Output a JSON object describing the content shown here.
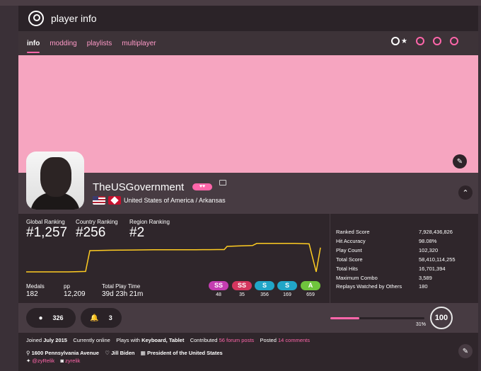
{
  "header": {
    "title": "player info"
  },
  "tabs": [
    {
      "label": "info",
      "active": true
    },
    {
      "label": "modding",
      "active": false
    },
    {
      "label": "playlists",
      "active": false
    },
    {
      "label": "multiplayer",
      "active": false
    }
  ],
  "modes": [
    "osu-icon",
    "taiko-icon",
    "catch-icon",
    "mania-icon"
  ],
  "profile": {
    "username": "TheUSGovernment",
    "supporter_badge": "♥♥",
    "location": "United States of America / Arkansas",
    "flags": [
      "us-flag-icon",
      "arkansas-flag-icon"
    ]
  },
  "rankings": {
    "global_label": "Global Ranking",
    "global_value": "#1,257",
    "country_label": "Country Ranking",
    "country_value": "#256",
    "region_label": "Region Ranking",
    "region_value": "#2"
  },
  "chart_data": {
    "type": "line",
    "title": "",
    "xlabel": "",
    "ylabel": "",
    "series": [
      {
        "values": [
          2400,
          2400,
          2400,
          2380,
          1400,
          1380,
          1370,
          1360,
          1360,
          1360,
          1355,
          1355,
          1350,
          1350,
          1200,
          1180,
          1160,
          1060,
          1060,
          1060,
          1060,
          1080,
          2400,
          1257
        ]
      }
    ],
    "ylim": [
      1000,
      2600
    ]
  },
  "summary_stats": [
    {
      "label": "Medals",
      "value": "182"
    },
    {
      "label": "pp",
      "value": "12,209"
    },
    {
      "label": "Total Play Time",
      "value": "39d 23h 21m"
    }
  ],
  "grades": [
    {
      "label": "SS",
      "count": "48",
      "color": "#c43db1"
    },
    {
      "label": "SS",
      "count": "35",
      "color": "#d4365e"
    },
    {
      "label": "S",
      "count": "356",
      "color": "#21a5c7"
    },
    {
      "label": "S",
      "count": "169",
      "color": "#21a5c7"
    },
    {
      "label": "A",
      "count": "659",
      "color": "#6fc43d"
    }
  ],
  "detailed_stats": [
    {
      "label": "Ranked Score",
      "value": "7,928,436,826"
    },
    {
      "label": "Hit Accuracy",
      "value": "98.08%"
    },
    {
      "label": "Play Count",
      "value": "102,320"
    },
    {
      "label": "Total Score",
      "value": "58,410,114,255"
    },
    {
      "label": "Total Hits",
      "value": "16,701,394"
    },
    {
      "label": "Maximum Combo",
      "value": "3,589"
    },
    {
      "label": "Replays Watched by Others",
      "value": "180"
    }
  ],
  "social": {
    "friends": "326",
    "mapping_followers": "3"
  },
  "level": {
    "value": "100",
    "progress_pct": "31%",
    "progress_fraction": 0.31
  },
  "info": {
    "joined_prefix": "Joined",
    "joined_value": "July 2015",
    "online": "Currently online",
    "plays_prefix": "Plays with",
    "plays_value": "Keyboard, Tablet",
    "contributed_prefix": "Contributed",
    "contributed_value": "56 forum posts",
    "posted_prefix": "Posted",
    "posted_value": "14 comments",
    "address": "1600 Pennsylvania Avenue",
    "interest": "Jill Biden",
    "occupation": "President of the United States",
    "twitter": "@zyRelik",
    "discord": "zyrelik"
  }
}
